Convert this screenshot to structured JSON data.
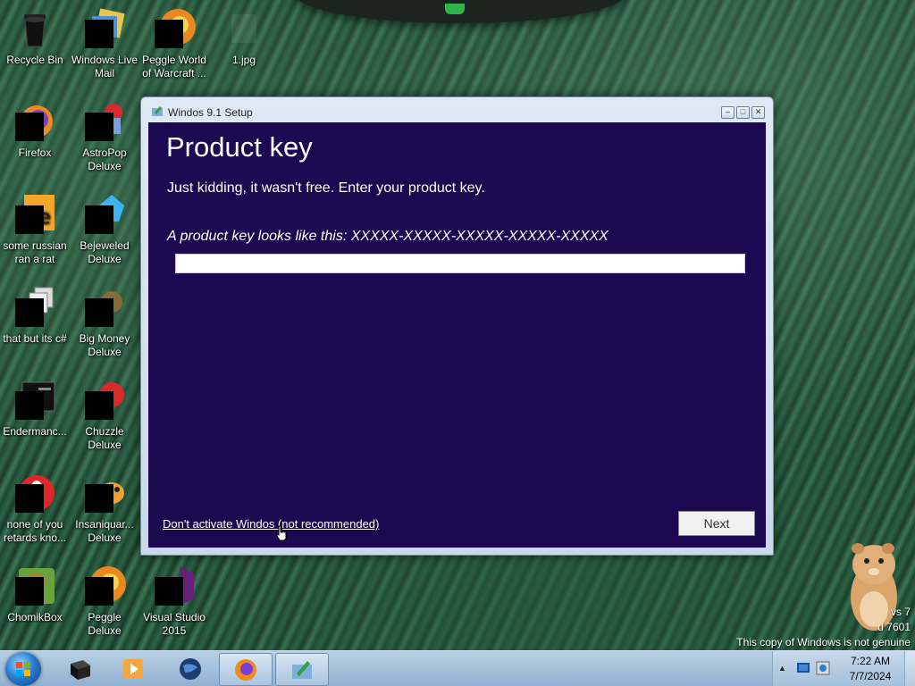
{
  "desktop": {
    "icons": [
      {
        "label": "Recycle Bin",
        "icon": "recycle-bin-icon"
      },
      {
        "label": "Windows Live Mail",
        "icon": "mail-icon"
      },
      {
        "label": "Peggle World of Warcraft ...",
        "icon": "peggle-icon"
      },
      {
        "label": "1.jpg",
        "icon": "image-file-icon"
      },
      {
        "label": "Firefox",
        "icon": "firefox-icon"
      },
      {
        "label": "AstroPop Deluxe",
        "icon": "astropop-icon"
      },
      {
        "label": "some russian ran a rat",
        "icon": "java-icon"
      },
      {
        "label": "Bejeweled Deluxe",
        "icon": "bejeweled-icon"
      },
      {
        "label": "that but its c#",
        "icon": "windows-stack-icon"
      },
      {
        "label": "Big Money Deluxe",
        "icon": "big-money-icon"
      },
      {
        "label": "Endermanc...",
        "icon": "terminal-icon"
      },
      {
        "label": "Chuzzle Deluxe",
        "icon": "chuzzle-icon"
      },
      {
        "label": "none of you retards kno...",
        "icon": "opera-icon"
      },
      {
        "label": "Insaniquar... Deluxe",
        "icon": "insaniquarium-icon"
      },
      {
        "label": "ChomikBox",
        "icon": "chomikbox-icon"
      },
      {
        "label": "Peggle Deluxe",
        "icon": "peggle-icon"
      },
      {
        "label": "Visual Studio 2015",
        "icon": "visual-studio-icon"
      }
    ],
    "watermark": {
      "line1": "vs 7",
      "line2": "d 7601",
      "line3": "This copy of Windows is not genuine"
    }
  },
  "setup_window": {
    "title": "Windos 9.1 Setup",
    "heading": "Product key",
    "subtitle": "Just kidding, it wasn't free. Enter your product key.",
    "hint": "A product key looks like this: XXXXX-XXXXX-XXXXX-XXXXX-XXXXX",
    "input_value": "",
    "skip_link": "Don't activate Windos (not recommended)",
    "next_label": "Next",
    "colors": {
      "content_bg": "#1d0952",
      "text": "#ffffff"
    }
  },
  "taskbar": {
    "pinned": [
      {
        "icon": "black-cube-icon",
        "active": false
      },
      {
        "icon": "media-player-icon",
        "active": false
      },
      {
        "icon": "globe-icon",
        "active": false
      },
      {
        "icon": "firefox-icon",
        "active": true
      },
      {
        "icon": "setup-icon",
        "active": true
      }
    ],
    "clock": {
      "time": "7:22 AM",
      "date": "7/7/2024"
    }
  }
}
